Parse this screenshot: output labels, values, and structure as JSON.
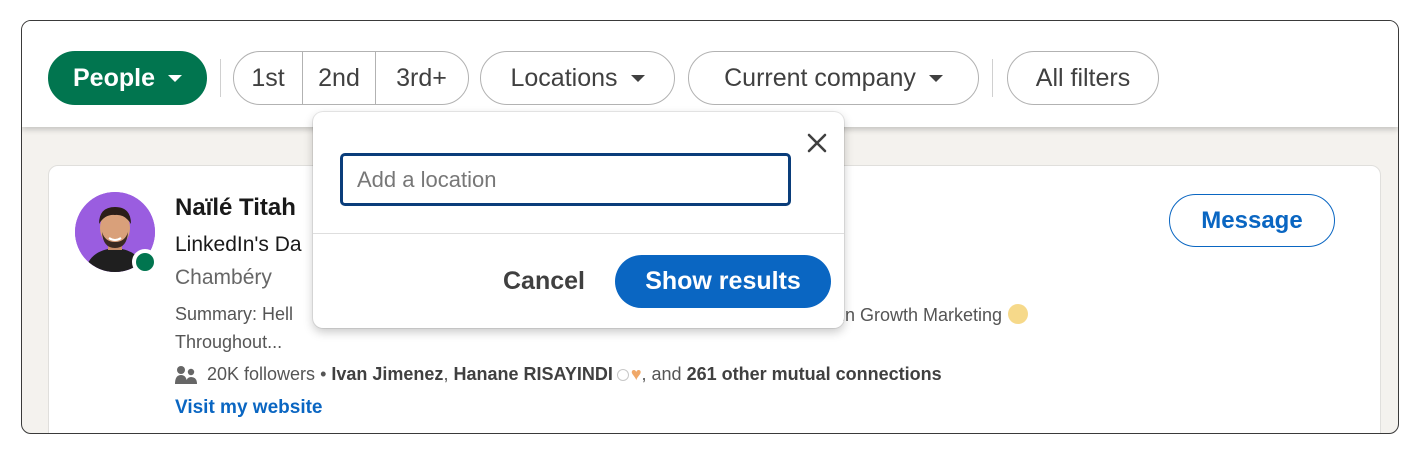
{
  "filters": {
    "people_label": "People",
    "degree_1": "1st",
    "degree_2": "2nd",
    "degree_3": "3rd+",
    "locations_label": "Locations",
    "company_label": "Current company",
    "all_filters_label": "All filters"
  },
  "result": {
    "name": "Naïlé Titah",
    "headline": "LinkedIn's Da",
    "location": "Chambéry",
    "summary_start": "Summary: Hell",
    "summary_end": "in Growth Marketing",
    "summary_line2": "Throughout...",
    "followers": "20K followers",
    "bullet": " • ",
    "mutual_1": "Ivan Jimenez",
    "comma": ", ",
    "mutual_2": "Hanane RISAYINDI",
    "and_text": ", and ",
    "mutual_more": "261 other mutual connections",
    "website_label": "Visit my website",
    "message_label": "Message"
  },
  "location_popover": {
    "input_placeholder": "Add a location",
    "input_value": "",
    "cancel_label": "Cancel",
    "show_results_label": "Show results"
  },
  "colors": {
    "people_green": "#01754f",
    "link_blue": "#0a66c2",
    "presence_green": "#01754f"
  },
  "icons": {
    "caret": "caret-down-icon",
    "close": "close-icon",
    "followers": "people-icon"
  }
}
